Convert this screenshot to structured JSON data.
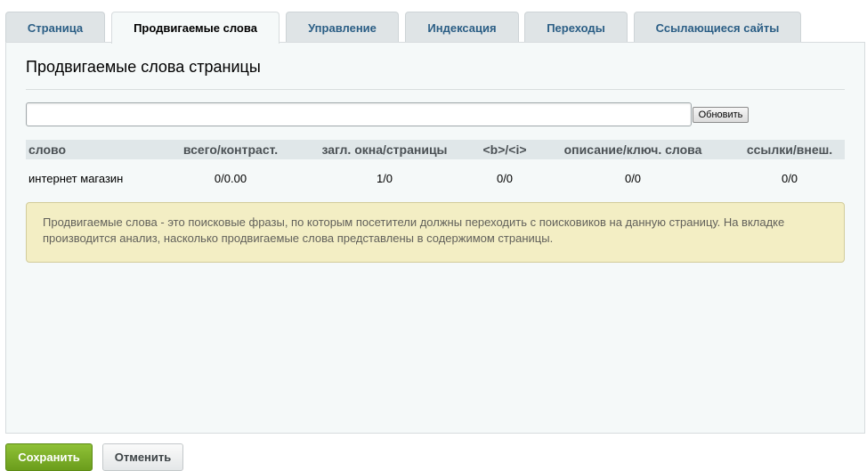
{
  "tabs": [
    {
      "label": "Страница",
      "active": false
    },
    {
      "label": "Продвигаемые слова",
      "active": true
    },
    {
      "label": "Управление",
      "active": false
    },
    {
      "label": "Индексация",
      "active": false
    },
    {
      "label": "Переходы",
      "active": false
    },
    {
      "label": "Ссылающиеся сайты",
      "active": false
    }
  ],
  "panel": {
    "title": "Продвигаемые слова страницы",
    "keyword_input": {
      "value": "",
      "placeholder": ""
    },
    "refresh_label": "Обновить"
  },
  "table": {
    "headers": [
      "слово",
      "всего/контраст.",
      "загл. окна/страницы",
      "<b>/<i>",
      "описание/ключ. слова",
      "ссылки/внеш."
    ],
    "rows": [
      [
        "интернет магазин",
        "0/0.00",
        "1/0",
        "0/0",
        "0/0",
        "0/0"
      ]
    ]
  },
  "note": "Продвигаемые слова - это поисковые фразы, по которым посетители должны переходить с поисковиков на данную страницу. На вкладке производится анализ, насколько продвигаемые слова представлены в содержимом страницы.",
  "footer": {
    "save_label": "Сохранить",
    "cancel_label": "Отменить"
  },
  "colors": {
    "tab_text": "#2b5e85",
    "panel_bg": "#f5f9f9",
    "note_bg": "#f3eec4",
    "save_green": "#7aad25"
  }
}
